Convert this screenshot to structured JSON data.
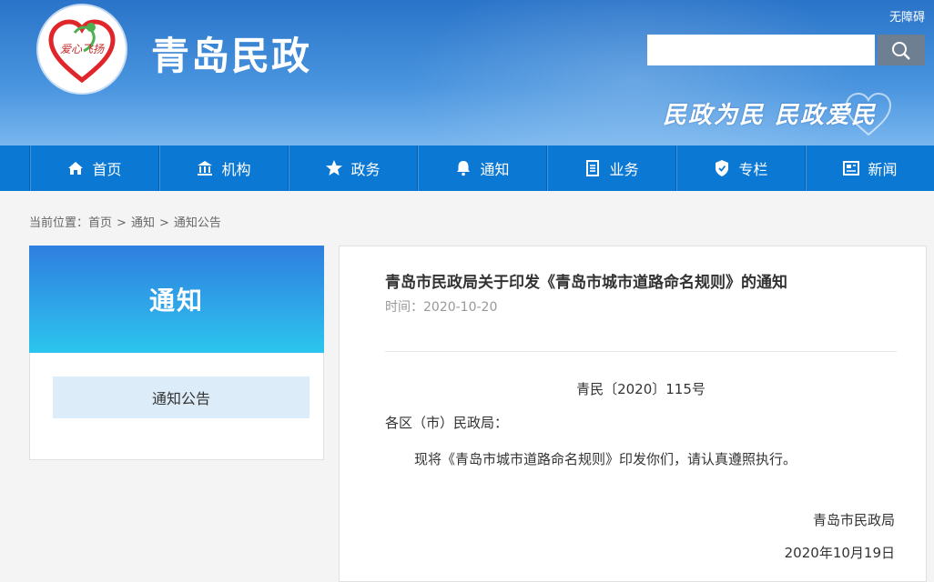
{
  "header": {
    "site_title": "青岛民政",
    "accessibility": "无障碍",
    "search": {
      "placeholder": "",
      "value": ""
    },
    "slogan": "民政为民  民政爱民",
    "logo_text": "爱心飞扬",
    "colors": {
      "header": "#2a74c9",
      "nav": "#0b78d4"
    }
  },
  "nav": {
    "items": [
      {
        "label": "首页",
        "icon": "home-icon"
      },
      {
        "label": "机构",
        "icon": "building-icon"
      },
      {
        "label": "政务",
        "icon": "star-icon"
      },
      {
        "label": "通知",
        "icon": "bell-icon"
      },
      {
        "label": "业务",
        "icon": "document-icon"
      },
      {
        "label": "专栏",
        "icon": "shield-icon"
      },
      {
        "label": "新闻",
        "icon": "news-icon"
      }
    ]
  },
  "breadcrumb": {
    "prefix": "当前位置：",
    "items": [
      "首页",
      "通知",
      "通知公告"
    ],
    "separator": ">"
  },
  "sidebar": {
    "title": "通知",
    "items": [
      "通知公告"
    ]
  },
  "article": {
    "title": "青岛市民政局关于印发《青岛市城市道路命名规则》的通知",
    "time": "时间：2020-10-20",
    "doc_number": "青民〔2020〕115号",
    "salutation": "各区（市）民政局：",
    "body": "现将《青岛市城市道路命名规则》印发你们，请认真遵照执行。",
    "signature": "青岛市民政局",
    "date": "2020年10月19日"
  }
}
